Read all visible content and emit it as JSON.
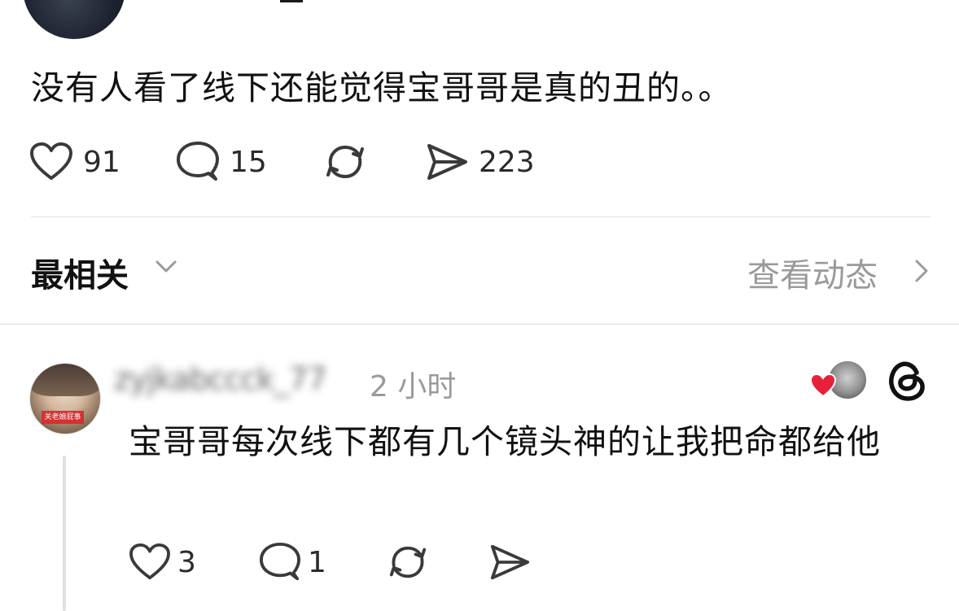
{
  "post": {
    "text": "没有人看了线下还能觉得宝哥哥是真的丑的。。",
    "actions": {
      "like_count": "91",
      "reply_count": "15",
      "share_count": "223"
    }
  },
  "replies_header": {
    "sort_label": "最相关",
    "activity_label": "查看动态"
  },
  "reply": {
    "username": "zyjkabccck_77",
    "time": "2 小时",
    "avatar_tag": "关老娘屁事",
    "text": "宝哥哥每次线下都有几个镜头神的让我把命都给他",
    "actions": {
      "like_count": "3",
      "reply_count": "1"
    }
  },
  "colors": {
    "text_primary": "#111111",
    "text_secondary": "#9a9a9a",
    "divider": "#e2e2e2",
    "liked_heart": "#e8213a"
  },
  "icons": [
    "heart-icon",
    "comment-icon",
    "repost-icon",
    "send-icon",
    "chevron-down-icon",
    "chevron-right-icon",
    "threads-logo-icon"
  ]
}
